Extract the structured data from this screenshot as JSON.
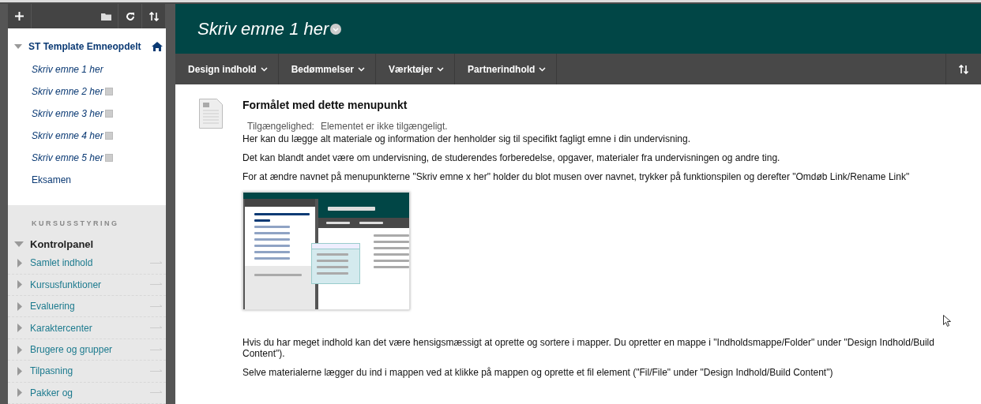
{
  "course": {
    "title": "ST Template Emneopdelt",
    "expanded": true,
    "items": [
      {
        "label": "Skriv emne 1 her",
        "kind": "topic",
        "hidden": false
      },
      {
        "label": "Skriv emne 2 her",
        "kind": "topic",
        "hidden": true
      },
      {
        "label": "Skriv emne 3 her",
        "kind": "topic",
        "hidden": true
      },
      {
        "label": "Skriv emne 4 her",
        "kind": "topic",
        "hidden": true
      },
      {
        "label": "Skriv emne 5 her",
        "kind": "topic",
        "hidden": true
      },
      {
        "label": "Eksamen",
        "kind": "plain",
        "hidden": false
      }
    ]
  },
  "management": {
    "heading": "KURSUSSTYRING",
    "panel": {
      "title": "Kontrolpanel",
      "expanded": true,
      "items": [
        "Samlet indhold",
        "Kursusfunktioner",
        "Evaluering",
        "Karaktercenter",
        "Brugere og grupper",
        "Tilpasning",
        "Pakker og"
      ]
    }
  },
  "header": {
    "title": "Skriv emne 1 her"
  },
  "nav": [
    "Design indhold",
    "Bedømmelser",
    "Værktøjer",
    "Partnerindhold"
  ],
  "content": {
    "title": "Formålet med dette menupunkt",
    "availability_label": "Tilgængelighed:",
    "availability_value": "Elementet er ikke tilgængeligt.",
    "paragraphs_before": [
      "Her kan du lægge alt materiale og information der henholder sig til specifikt fagligt emne i din undervisning.",
      "Det kan blandt andet være om undervisning, de studerendes forberedelse, opgaver, materialer fra undervisningen og andre ting.",
      "For at ændre navnet på menupunkterne \"Skriv emne x her\" holder du blot musen over navnet, trykker på funktionspilen og derefter \"Omdøb Link/Rename Link\""
    ],
    "paragraphs_after": [
      "Hvis du har meget indhold kan det være hensigsmæssigt at oprette og sortere i mapper. Du opretter en mappe i \"Indholdsmappe/Folder\" under \"Design Indhold/Build Content\").",
      "Selve materialerne lægger du ind i mappen ved at klikke på mappen og oprette et fil element (\"Fil/File\" under \"Design Indhold/Build Content\")"
    ]
  }
}
